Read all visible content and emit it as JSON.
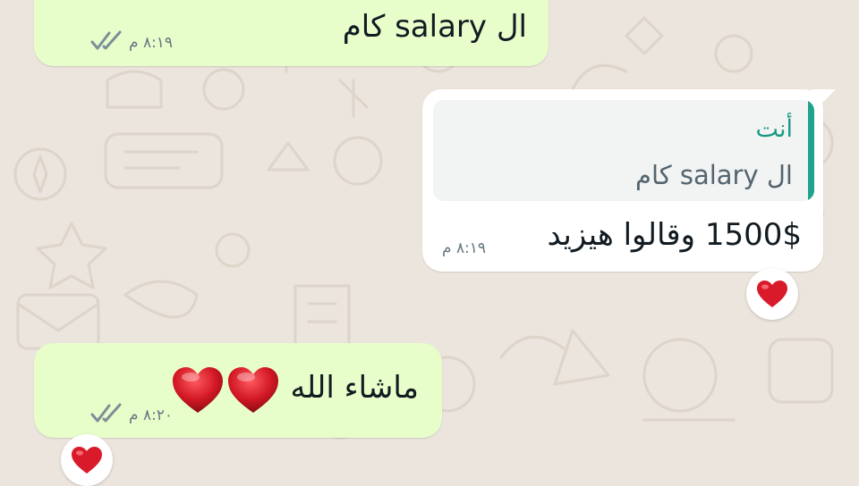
{
  "chat": {
    "messages": [
      {
        "direction": "outgoing",
        "text": "ال salary كام",
        "time": "٨:١٩ م",
        "status": "read"
      },
      {
        "direction": "incoming",
        "quoted": {
          "author": "أنت",
          "text": "ال salary كام"
        },
        "text": "1500$ وقالوا هيزيد",
        "time": "٨:١٩ م",
        "reaction": "red-heart"
      },
      {
        "direction": "outgoing",
        "text": "ماشاء الله",
        "emoji": "two-red-hearts",
        "time": "٨:٢٠ م",
        "status": "read",
        "reaction": "red-heart"
      }
    ]
  },
  "colors": {
    "wallpaper": "#ece5dd",
    "outgoing_bubble": "#e7fecb",
    "incoming_bubble": "#ffffff",
    "quote_accent": "#1fa38d",
    "read_ticks": "#7d8e98",
    "heart": "#d91a2a"
  }
}
